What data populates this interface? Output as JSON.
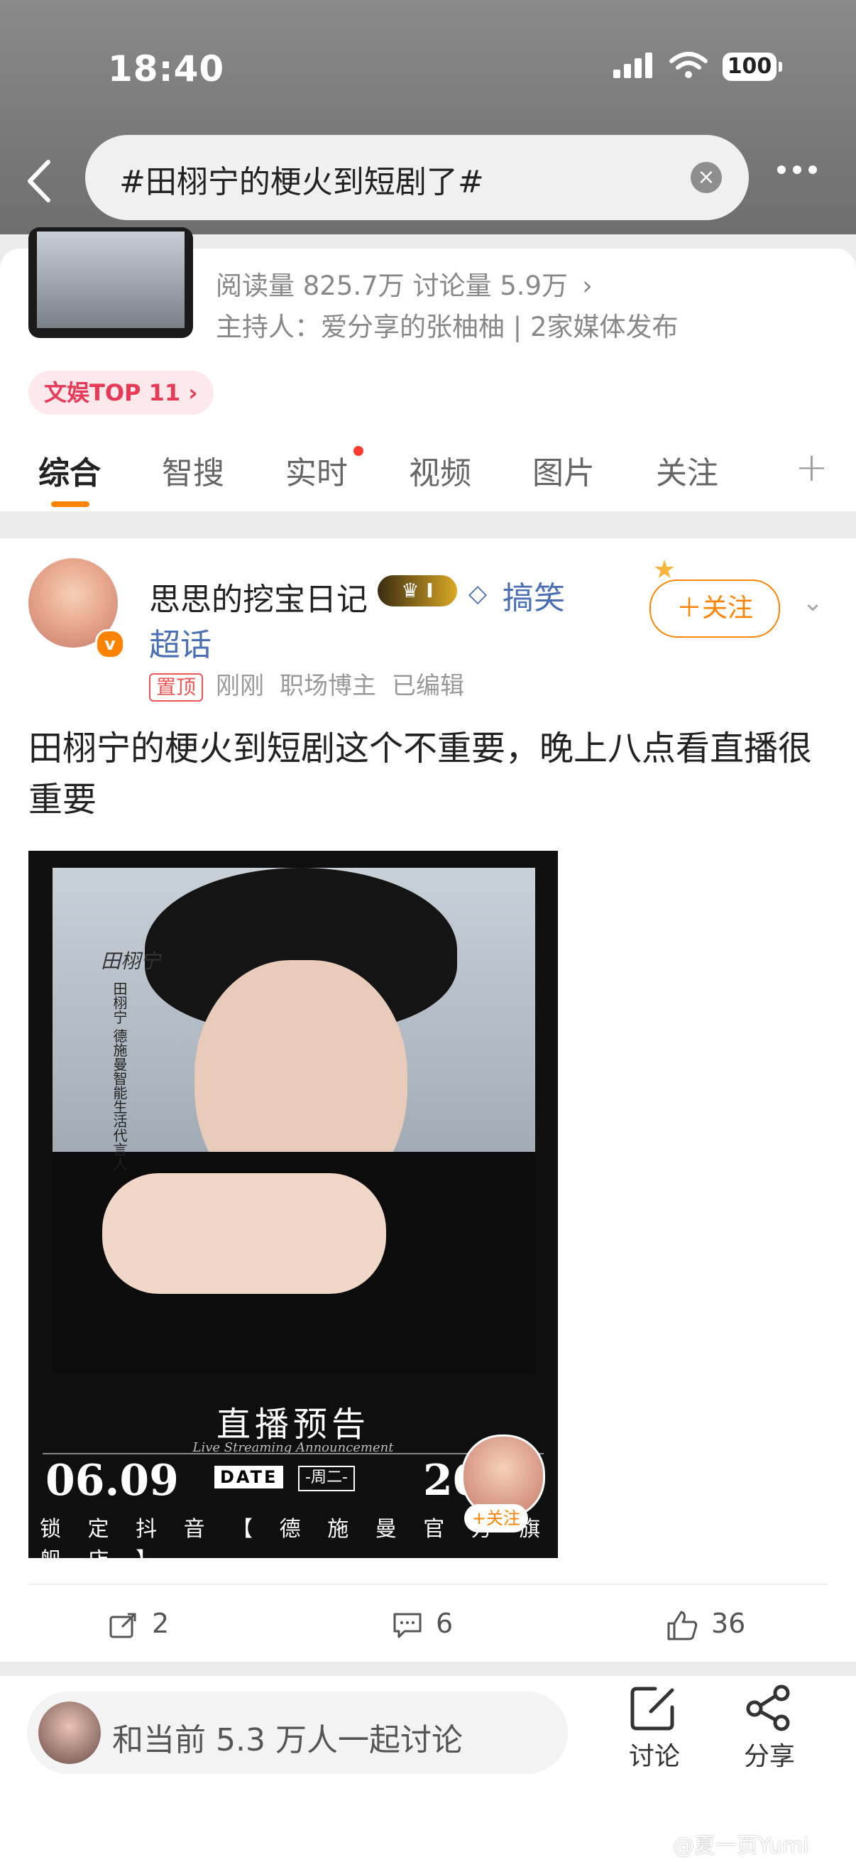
{
  "status": {
    "time": "18:40",
    "battery": "100"
  },
  "nav": {
    "search_query": "#田栩宁的梗火到短剧了#",
    "clear_symbol": "×"
  },
  "topic": {
    "stats": "阅读量 825.7万  讨论量 5.9万",
    "host": "主持人：爱分享的张柚柚 | 2家媒体发布",
    "badge": "文娱TOP 11 ›"
  },
  "tabs": [
    "综合",
    "智搜",
    "实时",
    "视频",
    "图片",
    "关注"
  ],
  "post": {
    "username": "思思的挖宝日记",
    "crown_badge": "I",
    "tag1": "搞笑",
    "tag2": "超话",
    "pinned": "置顶",
    "time": "刚刚",
    "role": "职场博主",
    "edited": "已编辑",
    "follow_label": "＋关注",
    "content": "田栩宁的梗火到短剧这个不重要，晚上八点看直播很重要",
    "image": {
      "signature": "田栩宁",
      "vertical_text": "田栩宁 德施曼智能生活代言人",
      "title": "直播预告",
      "subtitle": "Live Streaming Announcement",
      "date": "06.09",
      "date_label": "DATE",
      "weekday": "-周二-",
      "year": "20",
      "bottom": "锁 定 抖 音 【 德 施 曼 官 方 旗 舰 店 】",
      "mini_follow": "+关注"
    },
    "reposts": "2",
    "comments": "6",
    "likes": "36"
  },
  "bottom": {
    "input_placeholder": "和当前 5.3 万人一起讨论",
    "discuss_label": "讨论",
    "share_label": "分享"
  },
  "watermark": "@夏一页Yumi",
  "colors": {
    "accent": "#ff8200",
    "link": "#4a6fb5",
    "hot": "#e63a57"
  }
}
